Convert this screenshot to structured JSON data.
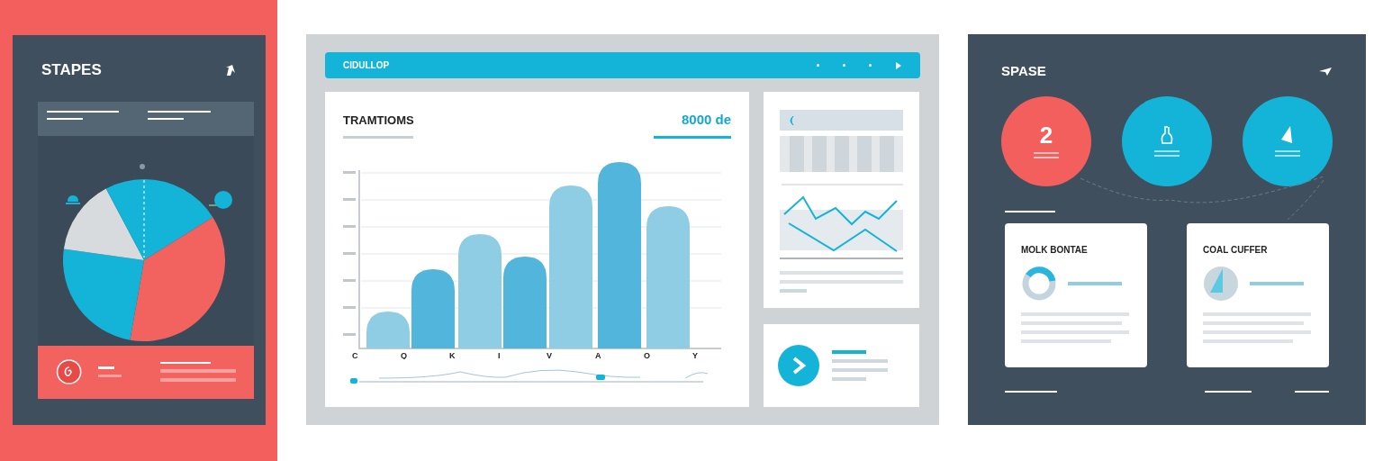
{
  "left_panel": {
    "title": "STAPES"
  },
  "main": {
    "header": {
      "title": "CIDULLOP"
    },
    "chart_card": {
      "title": "TRAMTIOMS",
      "value": "8000 de",
      "x_labels": [
        "C",
        "Q",
        "K",
        "I",
        "V",
        "A",
        "O",
        "Y"
      ],
      "range_slider": {
        "level": 0.7
      }
    }
  },
  "right_panel": {
    "title": "SPASE",
    "stats": [
      {
        "kind": "number",
        "value": "2",
        "color": "#f25f5c"
      },
      {
        "kind": "icon",
        "color": "#14b4d8"
      },
      {
        "kind": "icon",
        "color": "#14b4d8"
      }
    ],
    "cards": [
      {
        "title": "MOLK BONTAE"
      },
      {
        "title": "COAL CUFFER"
      }
    ]
  }
}
